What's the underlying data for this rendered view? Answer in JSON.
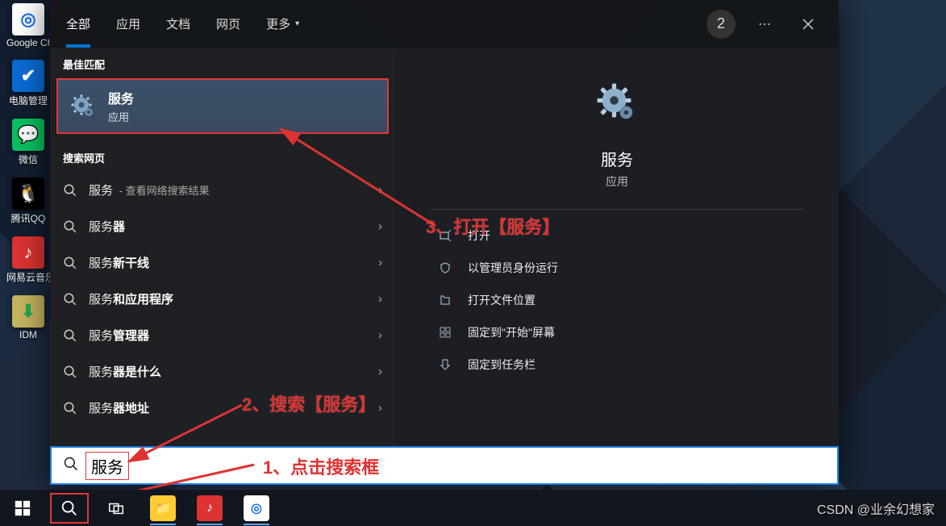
{
  "desktop_icons": [
    {
      "label": "Google Chrome",
      "color": "#fff",
      "glyph": "◎",
      "bg": "#fff",
      "fg": "#1a73e8"
    },
    {
      "label": "电脑管理",
      "color": "#fff",
      "glyph": "✔",
      "bg": "#0a6cd6",
      "fg": "#fff"
    },
    {
      "label": "微信",
      "glyph": "💬",
      "bg": "#07c160",
      "fg": "#fff"
    },
    {
      "label": "腾讯QQ",
      "glyph": "🐧",
      "bg": "#000",
      "fg": "#fff"
    },
    {
      "label": "网易云音乐",
      "glyph": "♪",
      "bg": "#d33",
      "fg": "#fff"
    },
    {
      "label": "IDM",
      "glyph": "⬇",
      "bg": "#c8b560",
      "fg": "#2a5"
    }
  ],
  "header": {
    "tabs": [
      "全部",
      "应用",
      "文档",
      "网页"
    ],
    "more": "更多",
    "badge": "2"
  },
  "sections": {
    "best": "最佳匹配",
    "web": "搜索网页"
  },
  "best_match": {
    "title": "服务",
    "subtitle": "应用"
  },
  "web_rows": [
    {
      "prefix": "服务",
      "bold": "",
      "hint": " - 查看网络搜索结果"
    },
    {
      "prefix": "服务",
      "bold": "器",
      "hint": ""
    },
    {
      "prefix": "服务",
      "bold": "新干线",
      "hint": ""
    },
    {
      "prefix": "服务",
      "bold": "和应用程序",
      "hint": ""
    },
    {
      "prefix": "服务",
      "bold": "管理器",
      "hint": ""
    },
    {
      "prefix": "服务",
      "bold": "器是什么",
      "hint": ""
    },
    {
      "prefix": "服务",
      "bold": "器地址",
      "hint": ""
    }
  ],
  "detail": {
    "title": "服务",
    "sub": "应用"
  },
  "actions": [
    "打开",
    "以管理员身份运行",
    "打开文件位置",
    "固定到\"开始\"屏幕",
    "固定到任务栏"
  ],
  "search_term": "服务",
  "annotations": {
    "a1": "1、点击搜索框",
    "a2": "2、搜索【服务】",
    "a3": "3、打开【服务】"
  },
  "watermark": "CSDN @业余幻想家",
  "taskbar_apps": [
    {
      "name": "file-explorer",
      "bg": "#ffcc33",
      "glyph": "📁"
    },
    {
      "name": "netease",
      "bg": "#d33",
      "glyph": "♪"
    },
    {
      "name": "chrome",
      "bg": "#fff",
      "glyph": "◎"
    }
  ]
}
